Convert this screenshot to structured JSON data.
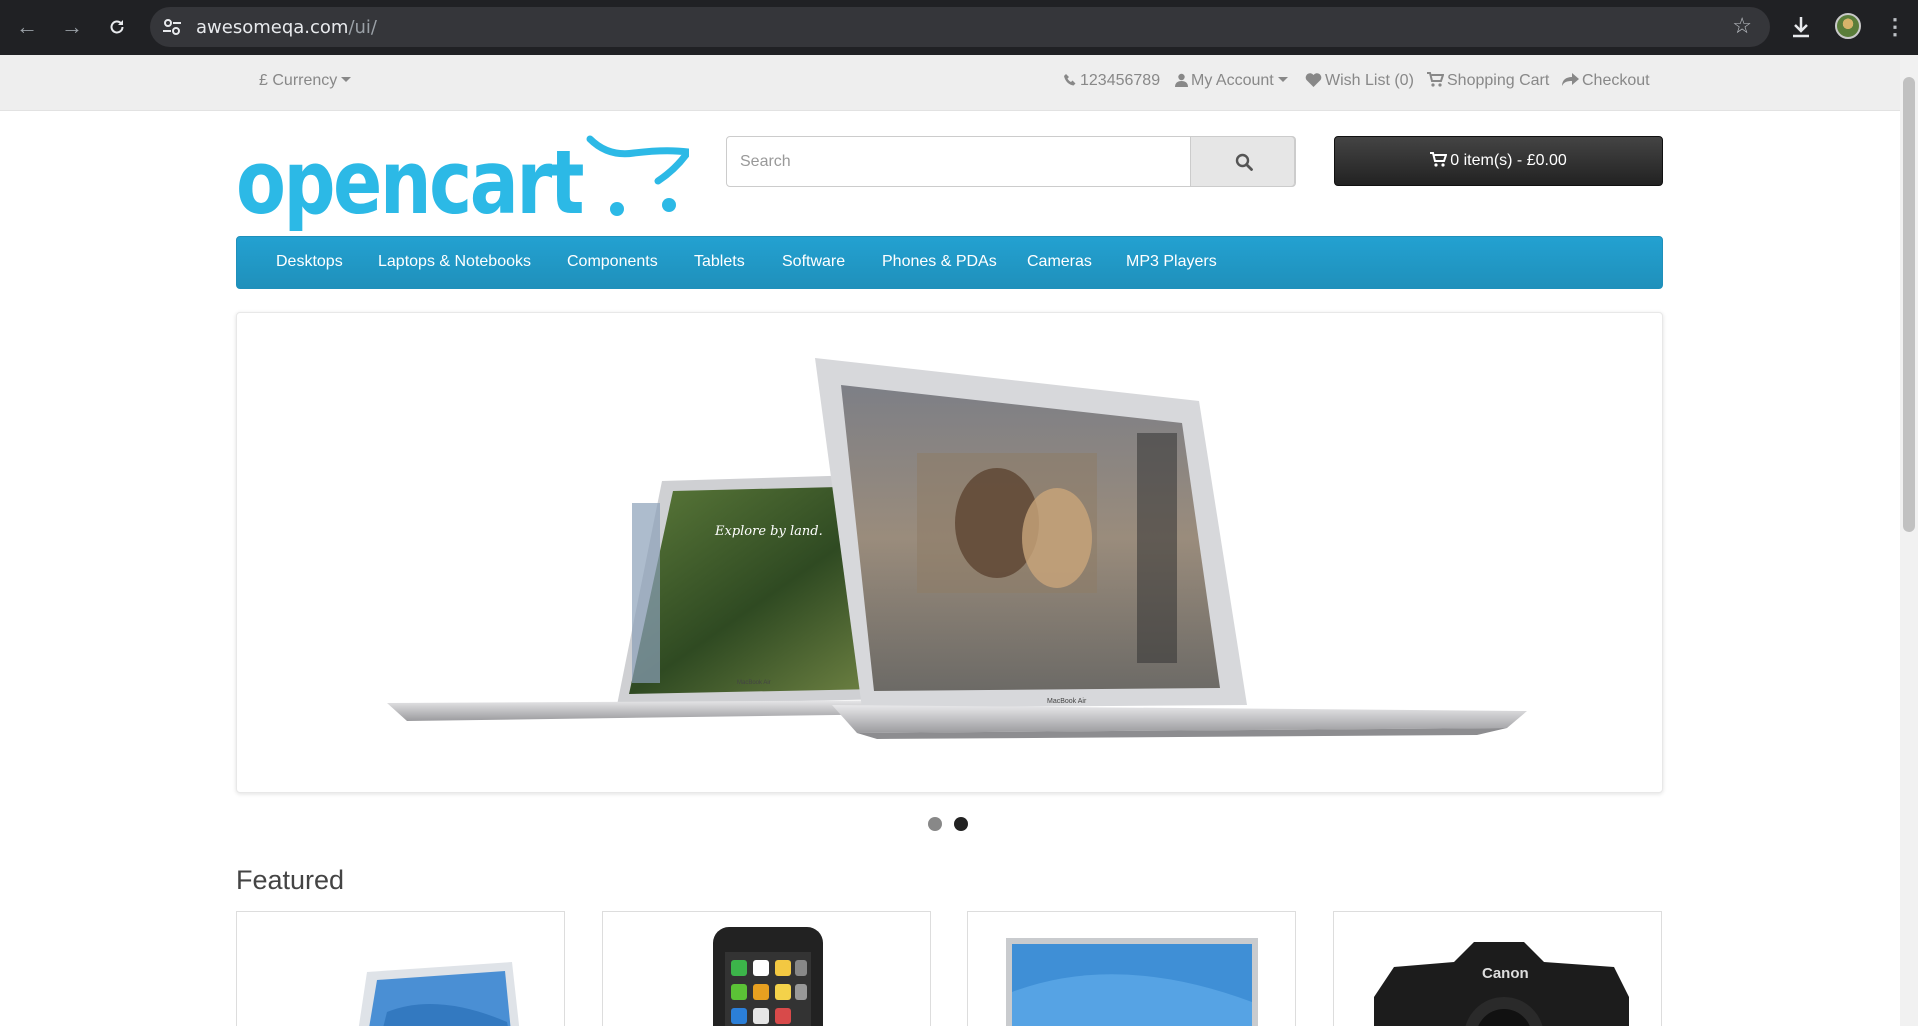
{
  "browser": {
    "url_host": "awesomeqa.com",
    "url_path": "/ui/",
    "icons": [
      "back-icon",
      "forward-icon",
      "reload-icon",
      "site-settings-icon",
      "bookmark-star-icon",
      "download-icon",
      "profile-avatar",
      "kebab-menu-icon"
    ]
  },
  "topbar": {
    "currency_symbol": "£",
    "currency_label": "Currency",
    "phone": "123456789",
    "my_account": "My Account",
    "wish_list": "Wish List (0)",
    "shopping_cart": "Shopping Cart",
    "checkout": "Checkout"
  },
  "header": {
    "logo_text": "opencart",
    "search_placeholder": "Search",
    "cart_button": "0 item(s) - £0.00"
  },
  "menu": {
    "items": [
      "Desktops",
      "Laptops & Notebooks",
      "Components",
      "Tablets",
      "Software",
      "Phones & PDAs",
      "Cameras",
      "MP3 Players"
    ]
  },
  "slideshow": {
    "slide_count": 2,
    "active_slide": 2,
    "image_text": [
      "Explore by land.",
      "MacBook Air",
      "MacBook Air"
    ]
  },
  "featured": {
    "title": "Featured",
    "products": [
      "macbook-image",
      "iphone-image",
      "apple-cinema-display-image",
      "canon-camera-image"
    ],
    "camera_brand_text": "Canon"
  },
  "colors": {
    "brand_blue": "#229ac8",
    "logo_blue": "#2cb9e6",
    "topbar_bg": "#eeeeee",
    "cart_bg": "#333333"
  }
}
